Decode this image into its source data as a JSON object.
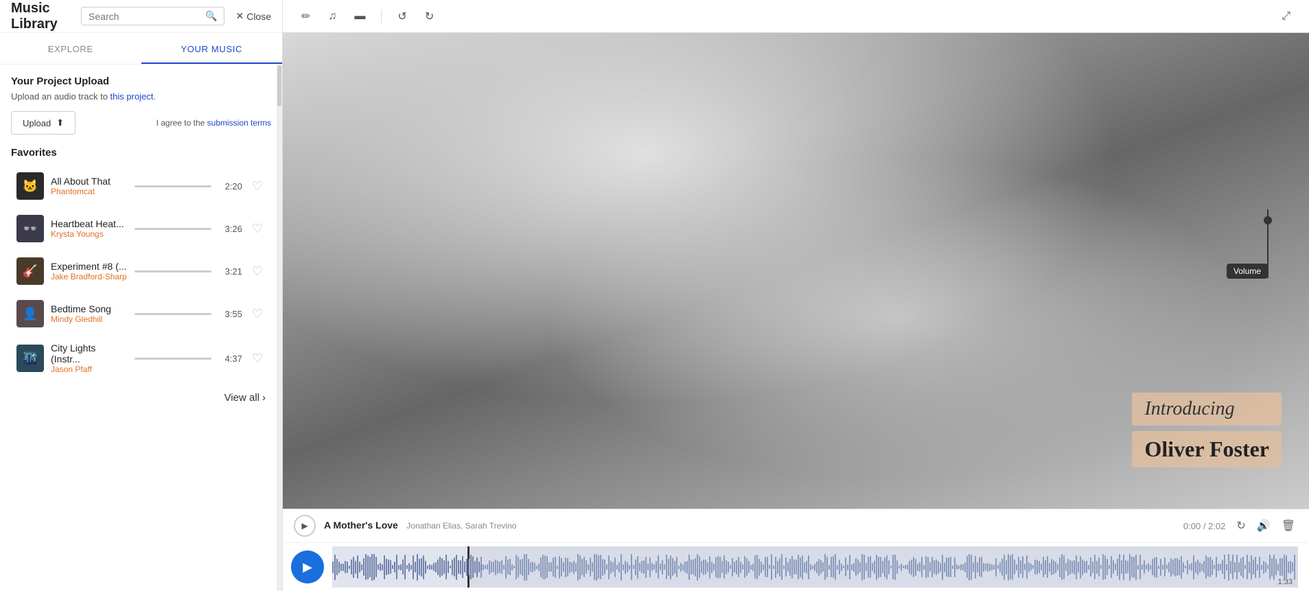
{
  "app": {
    "title": "Music Library",
    "close_label": "Close",
    "search_placeholder": "Search"
  },
  "tabs": {
    "explore": "EXPLORE",
    "your_music": "YOUR MUSIC",
    "active": "YOUR MUSIC"
  },
  "upload_section": {
    "title": "Your Project Upload",
    "description": "Upload an audio track to this project.",
    "description_link": "this project",
    "upload_btn": "Upload",
    "terms_prefix": "I agree to the",
    "terms_link": "submission terms"
  },
  "favorites": {
    "title": "Favorites",
    "tracks": [
      {
        "name": "All About That",
        "artist": "Phantomcat",
        "duration": "2:20",
        "thumb_icon": "🐱"
      },
      {
        "name": "Heartbeat Heat...",
        "artist": "Krysta Youngs",
        "duration": "3:26",
        "thumb_icon": "👓"
      },
      {
        "name": "Experiment #8 (...",
        "artist": "Jake Bradford-Sharp",
        "duration": "3:21",
        "thumb_icon": "🎸"
      },
      {
        "name": "Bedtime Song",
        "artist": "Mindy Gledhill",
        "duration": "3:55",
        "thumb_icon": "👤"
      },
      {
        "name": "City Lights (Instr...",
        "artist": "Jason Pfaff",
        "duration": "4:37",
        "thumb_icon": "🌃"
      }
    ]
  },
  "view_all": "View all",
  "toolbar": {
    "pencil_icon": "✏",
    "music_icon": "♫",
    "image_icon": "▬",
    "undo_icon": "↺",
    "redo_icon": "↻",
    "external_icon": "⤢"
  },
  "video_overlay": {
    "line1": "Introducing",
    "line2": "Oliver Foster"
  },
  "volume_tooltip": "Volume",
  "now_playing": {
    "title": "A Mother's Love",
    "artists": "Jonathan Elias, Sarah Trevino",
    "time_current": "0:00",
    "time_total": "2:02",
    "time_display": "0:00 / 2:02",
    "bottom_label": "1:33"
  }
}
